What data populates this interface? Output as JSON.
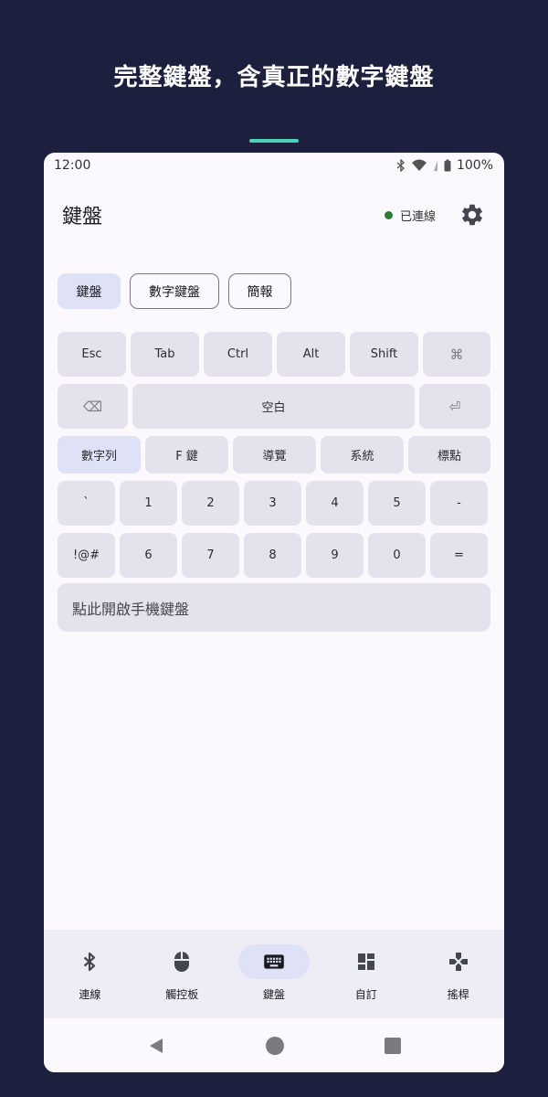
{
  "headline": "完整鍵盤，含真正的數字鍵盤",
  "status": {
    "time": "12:00",
    "battery": "100%"
  },
  "app": {
    "title": "鍵盤",
    "connection_status": "已連線",
    "connection_color": "#2e7d32"
  },
  "mode_tabs": [
    {
      "label": "鍵盤",
      "selected": true
    },
    {
      "label": "數字鍵盤",
      "selected": false
    },
    {
      "label": "簡報",
      "selected": false
    }
  ],
  "keys": {
    "row1": [
      "Esc",
      "Tab",
      "Ctrl",
      "Alt",
      "Shift",
      "⌘"
    ],
    "row2": [
      "⌫",
      "空白",
      "⏎"
    ],
    "row3": [
      "數字列",
      "F 鍵",
      "導覽",
      "系統",
      "標點"
    ],
    "row4": [
      "`",
      "1",
      "2",
      "3",
      "4",
      "5",
      "-"
    ],
    "row5": [
      "!@#",
      "6",
      "7",
      "8",
      "9",
      "0",
      "="
    ]
  },
  "text_input_prompt": "點此開啟手機鍵盤",
  "bottom_nav": [
    {
      "label": "連線",
      "icon": "bluetooth-icon",
      "selected": false
    },
    {
      "label": "觸控板",
      "icon": "mouse-icon",
      "selected": false
    },
    {
      "label": "鍵盤",
      "icon": "keyboard-icon",
      "selected": true
    },
    {
      "label": "自訂",
      "icon": "dashboard-icon",
      "selected": false
    },
    {
      "label": "搖桿",
      "icon": "gamepad-icon",
      "selected": false
    }
  ],
  "colors": {
    "background": "#1c1f3d",
    "accent": "#4fd1b8",
    "selected": "#dfe1f6",
    "key": "#e4e2ec"
  }
}
